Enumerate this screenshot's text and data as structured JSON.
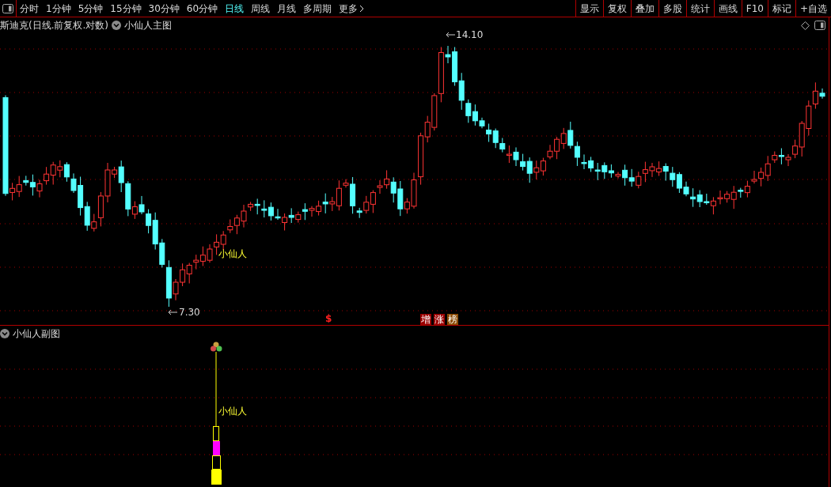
{
  "toolbar": {
    "periods": [
      {
        "label": "分时",
        "selected": false
      },
      {
        "label": "1分钟",
        "selected": false
      },
      {
        "label": "5分钟",
        "selected": false
      },
      {
        "label": "15分钟",
        "selected": false
      },
      {
        "label": "30分钟",
        "selected": false
      },
      {
        "label": "60分钟",
        "selected": false
      },
      {
        "label": "日线",
        "selected": true
      },
      {
        "label": "周线",
        "selected": false
      },
      {
        "label": "月线",
        "selected": false
      },
      {
        "label": "多周期",
        "selected": false
      }
    ],
    "more": "更多",
    "actions": [
      "显示",
      "复权",
      "叠加",
      "多股",
      "统计",
      "画线",
      "F10",
      "标记",
      "+自选"
    ]
  },
  "main_chart": {
    "title": "斯迪克(日线.前复权.对数)",
    "indicator": "小仙人主图",
    "high_label": "14.10",
    "low_label": "7.30",
    "signal_label": "小仙人",
    "marker": "$",
    "badges": [
      {
        "text": "增",
        "color": "#9b0000"
      },
      {
        "text": "涨",
        "color": "#9b0000"
      },
      {
        "text": "榜",
        "color": "#8a4a00"
      }
    ]
  },
  "sub_chart": {
    "indicator": "小仙人副图",
    "signal_label": "小仙人"
  }
}
